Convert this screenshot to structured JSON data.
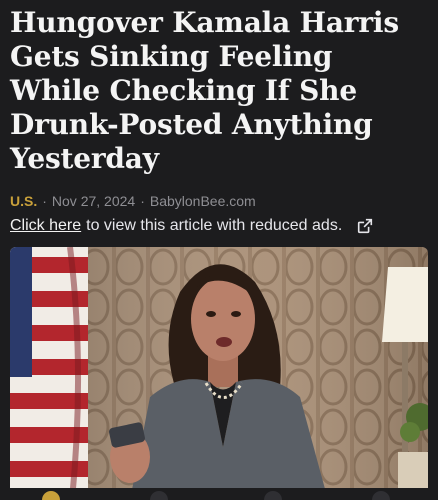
{
  "article": {
    "headline_lines": [
      "Hungover Kamala Harris",
      "Gets Sinking Feeling",
      "While Checking If She",
      "Drunk-Posted Anything",
      "Yesterday"
    ],
    "category": "U.S.",
    "separator": "·",
    "date": "Nov 27, 2024",
    "source": "BabylonBee.com"
  },
  "reduced_ads": {
    "link_text": "Click here",
    "rest_text": "to view this article with reduced ads."
  },
  "icons": {
    "external_link": "external-link-icon"
  },
  "colors": {
    "background": "#1c1c1e",
    "category": "#c8a03a",
    "meta_gray": "#8e8e93"
  }
}
